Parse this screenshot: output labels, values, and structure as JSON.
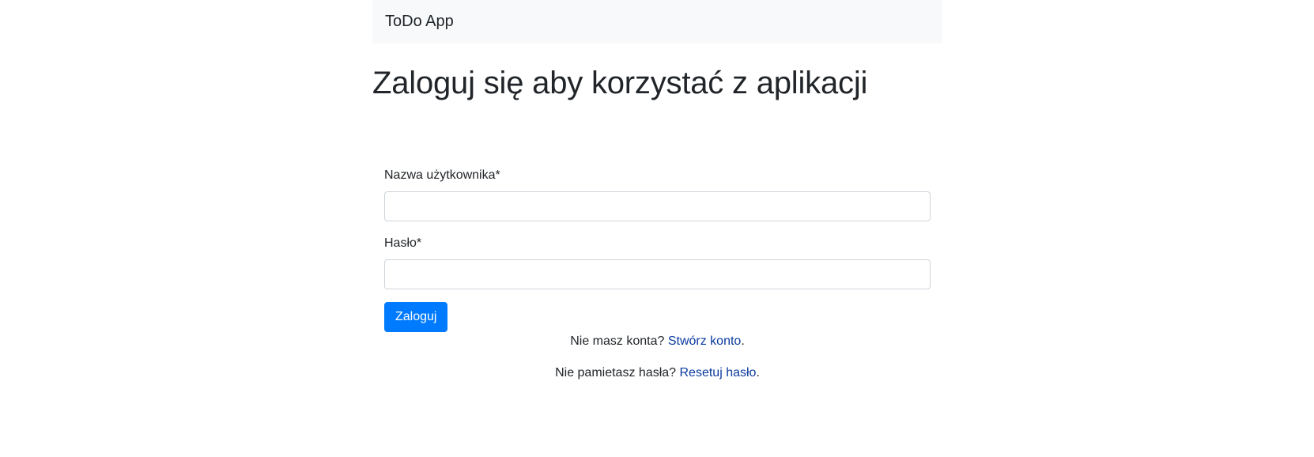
{
  "navbar": {
    "brand": "ToDo App"
  },
  "page": {
    "title": "Zaloguj się aby korzystać z aplikacji"
  },
  "form": {
    "username_label": "Nazwa użytkownika*",
    "username_value": "",
    "password_label": "Hasło*",
    "password_value": "",
    "submit_label": "Zaloguj"
  },
  "links": {
    "register_prefix": "Nie masz konta? ",
    "register_link": "Stwórz konto",
    "register_suffix": ".",
    "reset_prefix": "Nie pamietasz hasła? ",
    "reset_link": "Resetuj hasło",
    "reset_suffix": "."
  },
  "colors": {
    "primary": "#007bff",
    "link": "#0a3a9e",
    "navbar_bg": "#f8f9fa",
    "text": "#212529"
  }
}
